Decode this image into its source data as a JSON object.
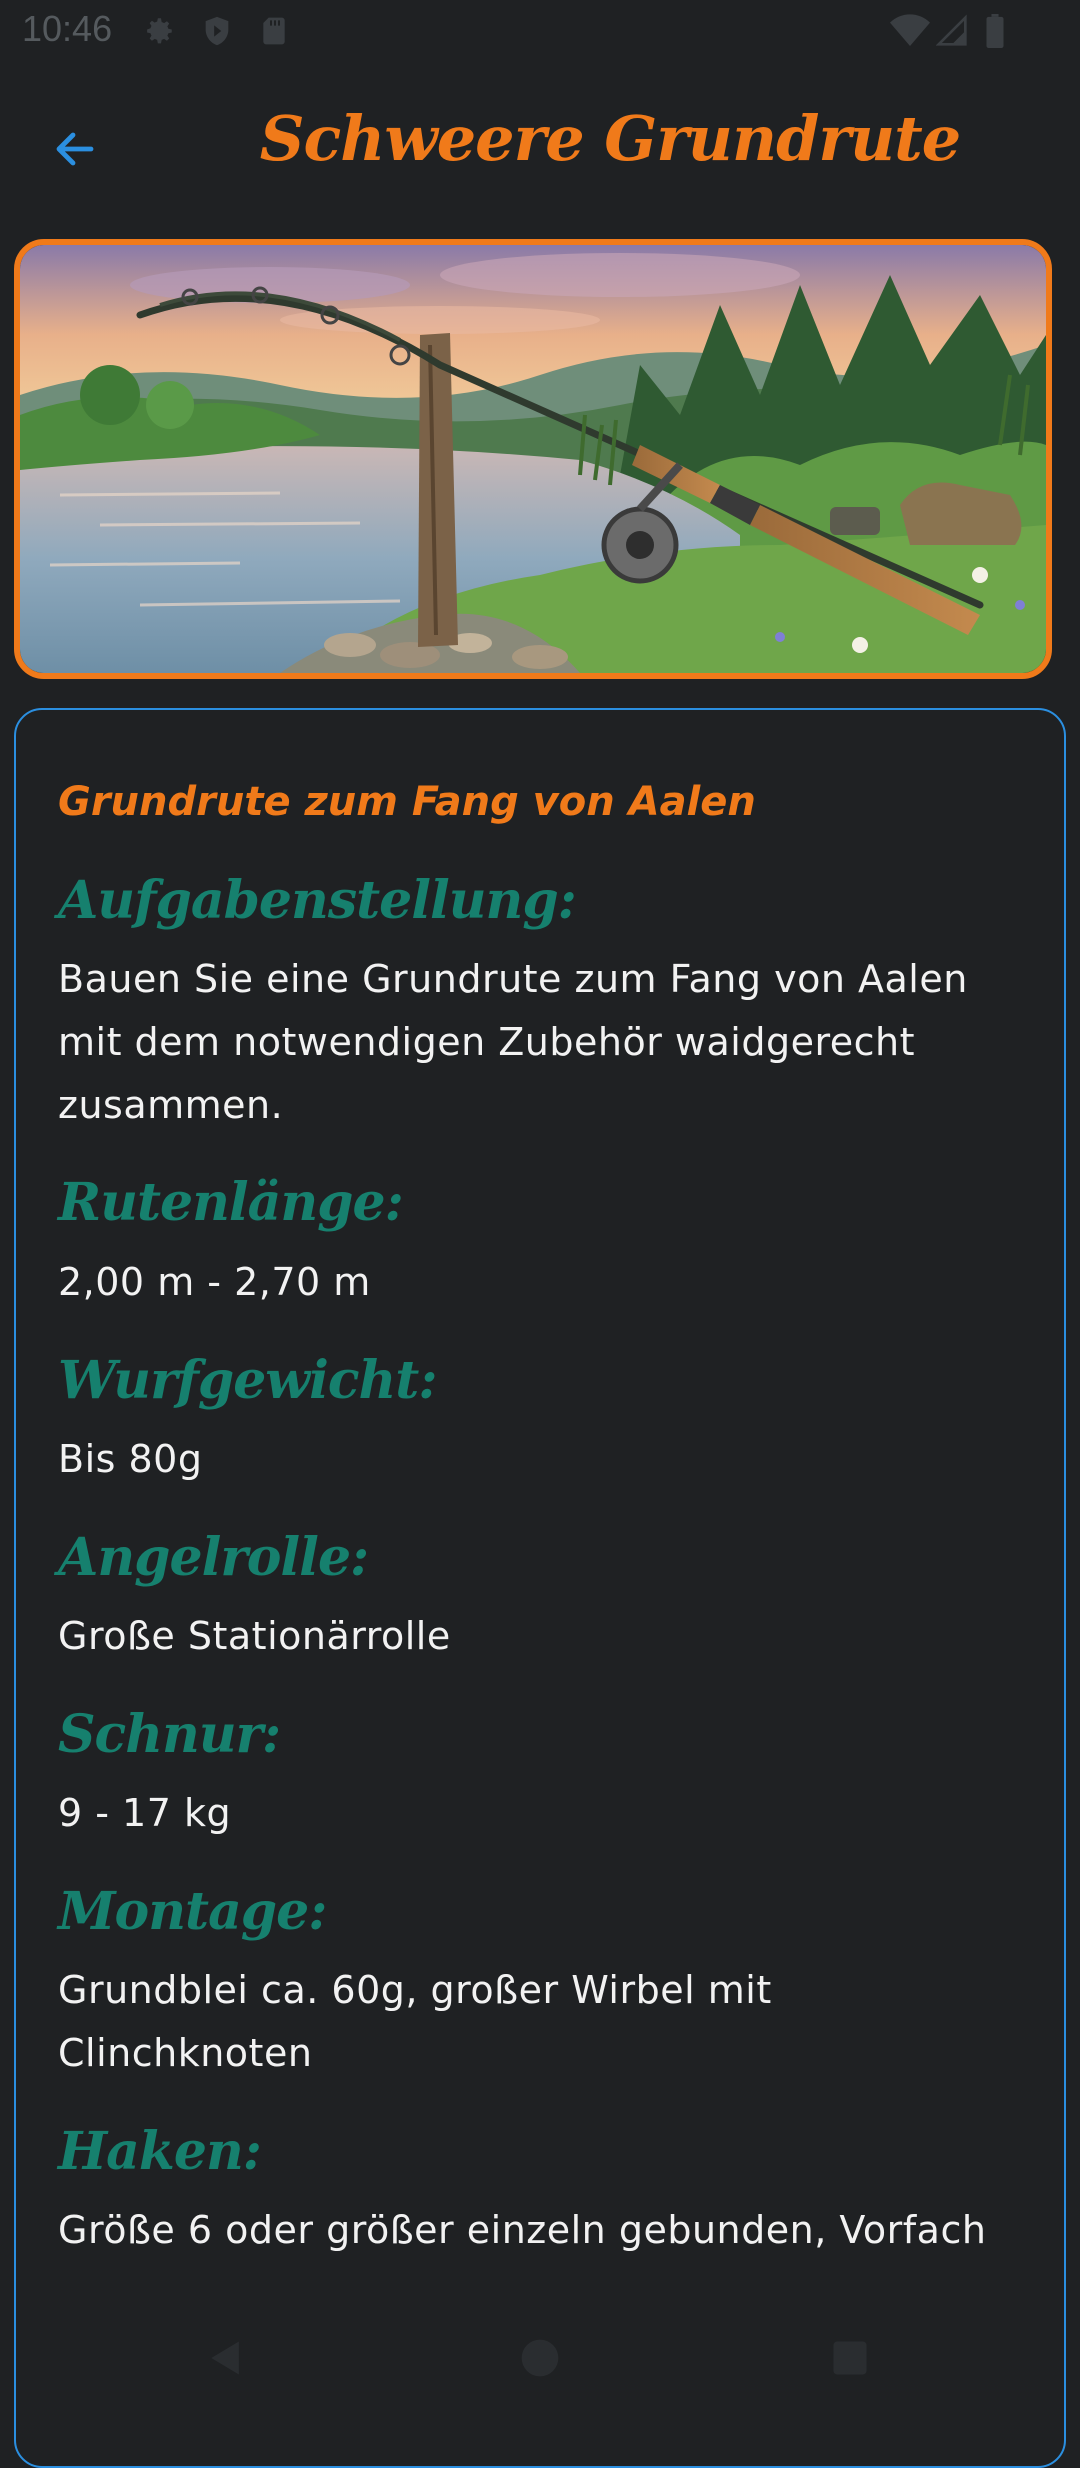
{
  "status_bar": {
    "time": "10:46",
    "icons": [
      "gear-icon",
      "shield-play-icon",
      "sd-card-icon",
      "wifi-icon",
      "signal-icon",
      "battery-icon"
    ]
  },
  "app_bar": {
    "title": "Schweere Grundrute",
    "back_icon": "arrow-left-icon"
  },
  "hero": {
    "image_alt": "fishing-rod-by-river-illustration"
  },
  "card": {
    "subtitle": "Grundrute zum Fang von Aalen",
    "sections": [
      {
        "heading": "Aufgabenstellung:",
        "value": "Bauen Sie eine Grundrute zum Fang von Aalen mit dem notwendigen Zubehör waidgerecht zusammen."
      },
      {
        "heading": "Rutenlänge:",
        "value": "2,00 m - 2,70 m"
      },
      {
        "heading": "Wurfgewicht:",
        "value": "Bis 80g"
      },
      {
        "heading": "Angelrolle:",
        "value": "Große Stationärrolle"
      },
      {
        "heading": "Schnur:",
        "value": "9 - 17 kg"
      },
      {
        "heading": "Montage:",
        "value": "Grundblei ca. 60g, großer Wirbel mit Clinchknoten"
      },
      {
        "heading": "Haken:",
        "value": "Größe 6 oder größer einzeln gebunden, Vorfach"
      }
    ]
  },
  "nav_bar": {
    "back": "nav-back-icon",
    "home": "nav-home-icon",
    "recents": "nav-recents-icon"
  },
  "colors": {
    "background": "#1f2123",
    "accent_orange": "#f07a1a",
    "heading_teal": "#16806e",
    "card_border_blue": "#2b8fe0",
    "back_arrow_blue": "#2b8fe0"
  }
}
